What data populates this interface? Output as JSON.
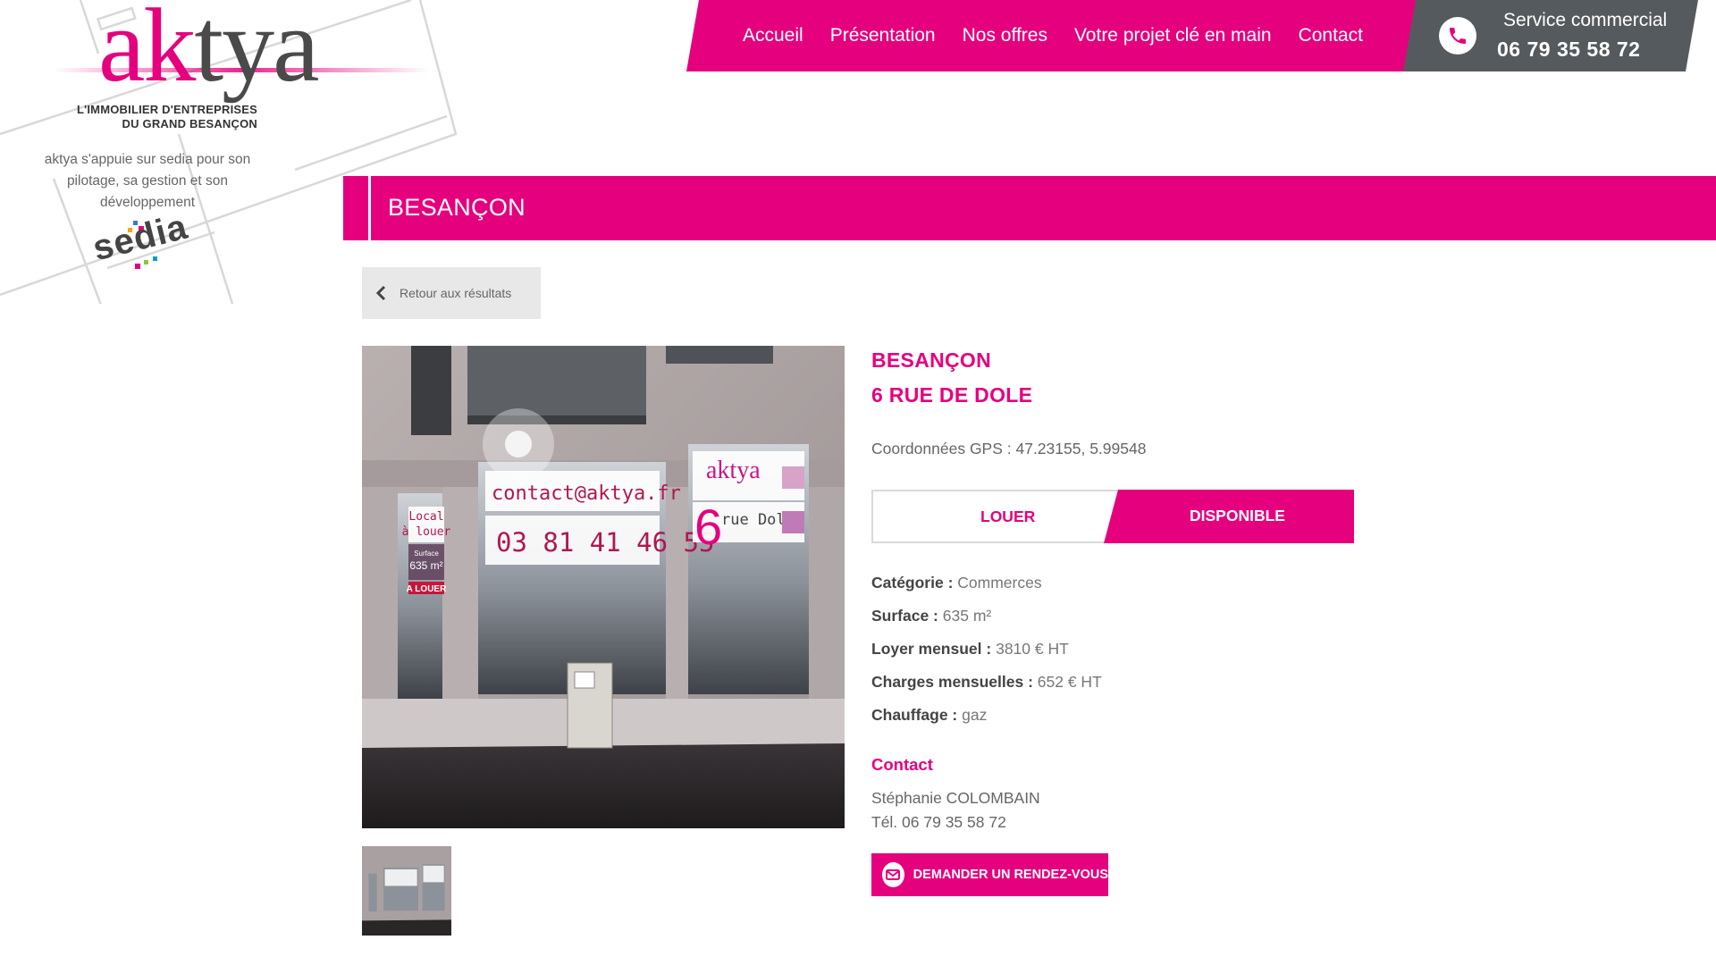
{
  "brand": {
    "logo_part1": "ak",
    "logo_part2": "t",
    "logo_part3": "ya",
    "tagline_line1": "L'IMMOBILIER D'ENTREPRISES",
    "tagline_line2": "DU GRAND BESANÇON",
    "sedia_text": "aktya s'appuie sur sedia pour son pilotage, sa gestion et son développement",
    "partner_logo": "sedia",
    "accent_color": "#e5007e",
    "dark_color": "#555a5e"
  },
  "nav": {
    "items": [
      "Accueil",
      "Présentation",
      "Nos offres",
      "Votre projet clé en main",
      "Contact"
    ]
  },
  "phone": {
    "icon": "phone-icon",
    "label": "Service commercial",
    "number": "06 79 35 58 72"
  },
  "page": {
    "title": "BESANÇON",
    "back_label": "Retour aux résultats"
  },
  "listing": {
    "city": "BESANÇON",
    "street": "6 RUE DE DOLE",
    "gps": "Coordonnées GPS : 47.23155, 5.99548",
    "status_left": "LOUER",
    "status_right": "DISPONIBLE",
    "specs": [
      {
        "label": "Catégorie :",
        "value": "Commerces"
      },
      {
        "label": "Surface :",
        "value": "635 m²"
      },
      {
        "label": "Loyer mensuel :",
        "value": "3810 € HT"
      },
      {
        "label": "Charges mensuelles :",
        "value": "652 € HT"
      },
      {
        "label": "Chauffage :",
        "value": "gaz"
      }
    ],
    "contact_title": "Contact",
    "contact_name": "Stéphanie COLOMBAIN",
    "contact_tel": "Tél. 06 79 35 58 72",
    "cta_label": "DEMANDER UN RENDEZ-VOUS",
    "cta_icon": "envelope-icon"
  },
  "photo": {
    "window_lines": [
      "Local",
      "à louer"
    ],
    "surface_label": "Surface",
    "surface_value": "635 m²",
    "banner": "A LOUER",
    "email": "contact@aktya.fr",
    "phone": "03 81 41 46 55",
    "street_number": "6",
    "street_name": "rue Dole",
    "logo": "aktya"
  }
}
